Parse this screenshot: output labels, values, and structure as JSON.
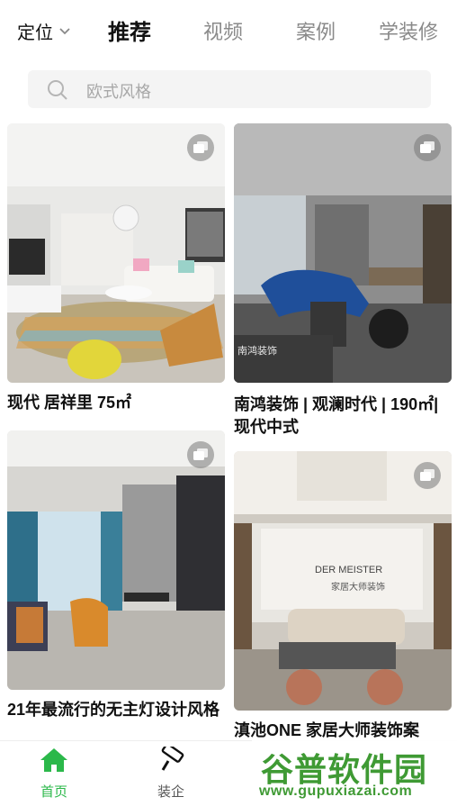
{
  "header": {
    "location_label": "定位",
    "tabs": [
      {
        "label": "推荐",
        "active": true
      },
      {
        "label": "视频",
        "active": false
      },
      {
        "label": "案例",
        "active": false
      },
      {
        "label": "学装修",
        "active": false
      }
    ]
  },
  "search": {
    "placeholder": "欧式风格",
    "icon": "search-icon"
  },
  "feed": {
    "cards": [
      {
        "title": "现代 居祥里  75㎡",
        "badge_icon": "gallery-icon"
      },
      {
        "title": "南鸿装饰 | 观澜时代 | 190㎡| 现代中式",
        "badge_icon": "gallery-icon",
        "image_caption": "南鸿装饰"
      },
      {
        "title": "21年最流行的无主灯设计风格",
        "badge_icon": "gallery-icon"
      },
      {
        "title": "滇池ONE 家居大师装饰案",
        "badge_icon": "gallery-icon",
        "image_caption": "DER MEISTER",
        "image_caption_2": "家居大师装饰"
      }
    ]
  },
  "bottom_nav": {
    "items": [
      {
        "label": "首页",
        "icon": "home-icon",
        "active": true
      },
      {
        "label": "装企",
        "icon": "paint-roller-icon",
        "active": false
      }
    ]
  },
  "watermark": {
    "text": "谷普软件园",
    "url": "www.gupuxiazai.com"
  },
  "colors": {
    "accent": "#2bb84a",
    "watermark": "#3f9a34",
    "inactive_tab": "#8a8a8a"
  }
}
